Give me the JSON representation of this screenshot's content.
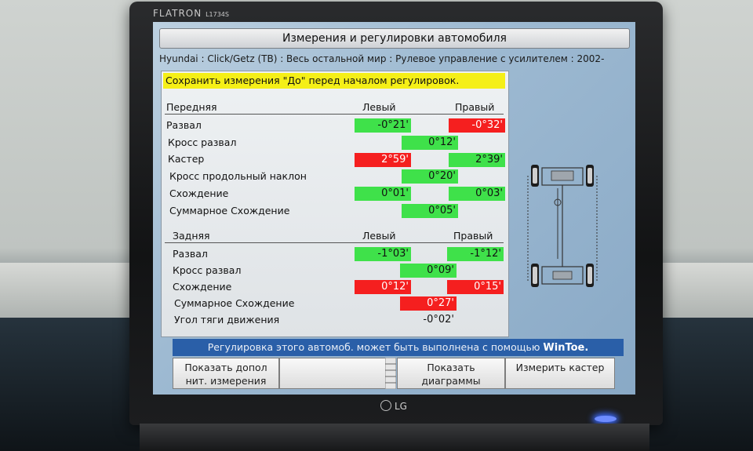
{
  "monitor": {
    "brand": "FLATRON",
    "model": "L1734S",
    "logo": "LG"
  },
  "app": {
    "title": "Измерения и регулировки автомобиля",
    "vehicle": "Hyundai : Click/Getz (TB) : Весь остальной мир : Рулевое управление с усилителем : 2002-",
    "notice": "Сохранить измерения \"До\" перед началом регулировок."
  },
  "front": {
    "heading": "Передняя",
    "left_col": "Левый",
    "right_col": "Правый",
    "rows": [
      {
        "label": "Развал",
        "left": "-0°21'",
        "left_status": "green",
        "right": "-0°32'",
        "right_status": "red"
      },
      {
        "label": "Кросс развал",
        "center": "0°12'",
        "center_status": "green"
      },
      {
        "label": "Кастер",
        "left": "2°59'",
        "left_status": "red",
        "right": "2°39'",
        "right_status": "green"
      },
      {
        "label": "Кросс продольный наклон",
        "center": "0°20'",
        "center_status": "green"
      },
      {
        "label": "Схождение",
        "left": "0°01'",
        "left_status": "green",
        "right": "0°03'",
        "right_status": "green"
      },
      {
        "label": "Суммарное Схождение",
        "center": "0°05'",
        "center_status": "green"
      }
    ]
  },
  "rear": {
    "heading": "Задняя",
    "left_col": "Левый",
    "right_col": "Правый",
    "rows": [
      {
        "label": "Развал",
        "left": "-1°03'",
        "left_status": "green",
        "right": "-1°12'",
        "right_status": "green"
      },
      {
        "label": "Кросс развал",
        "center": "0°09'",
        "center_status": "green"
      },
      {
        "label": "Схождение",
        "left": "0°12'",
        "left_status": "red",
        "right": "0°15'",
        "right_status": "red"
      },
      {
        "label": "Суммарное Схождение",
        "center": "0°27'",
        "center_status": "red"
      },
      {
        "label": "Угол тяги движения",
        "center": "-0°02'",
        "center_status": "plain"
      }
    ]
  },
  "footer": {
    "message": "Регулировка этого автомоб. может быть выполнена с помощью",
    "tool": "WinToe."
  },
  "buttons": {
    "show_additional": "Показать допол нит. измерения",
    "show_diagrams": "Показать диаграммы",
    "measure_caster": "Измерить кастер"
  },
  "colors": {
    "ok": "#3fe14a",
    "out_of_spec": "#f51f1f",
    "notice_bg": "#f5ef17",
    "footer_bg": "#2a5fa8"
  }
}
